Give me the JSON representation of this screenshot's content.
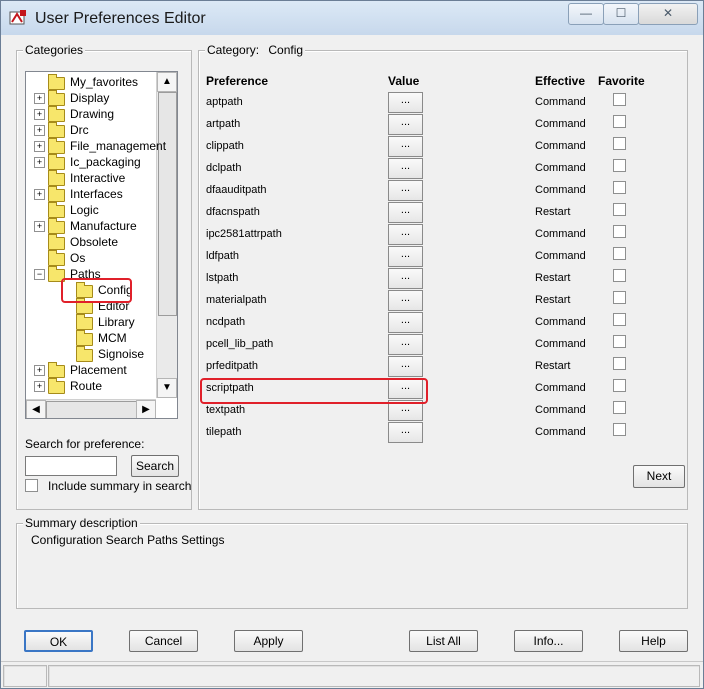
{
  "window": {
    "title": "User Preferences Editor",
    "minimize": "—",
    "maximize": "☐",
    "close": "✕"
  },
  "categories": {
    "label": "Categories",
    "items": [
      {
        "label": "My_favorites",
        "expander": ""
      },
      {
        "label": "Display",
        "expander": "+"
      },
      {
        "label": "Drawing",
        "expander": "+"
      },
      {
        "label": "Drc",
        "expander": "+"
      },
      {
        "label": "File_management",
        "expander": "+"
      },
      {
        "label": "Ic_packaging",
        "expander": "+"
      },
      {
        "label": "Interactive",
        "expander": ""
      },
      {
        "label": "Interfaces",
        "expander": "+"
      },
      {
        "label": "Logic",
        "expander": ""
      },
      {
        "label": "Manufacture",
        "expander": "+"
      },
      {
        "label": "Obsolete",
        "expander": ""
      },
      {
        "label": "Os",
        "expander": ""
      },
      {
        "label": "Paths",
        "expander": "−"
      },
      {
        "label": "Config",
        "expander": ""
      },
      {
        "label": "Editor",
        "expander": ""
      },
      {
        "label": "Library",
        "expander": ""
      },
      {
        "label": "MCM",
        "expander": ""
      },
      {
        "label": "Signoise",
        "expander": ""
      },
      {
        "label": "Placement",
        "expander": "+"
      },
      {
        "label": "Route",
        "expander": "+"
      }
    ],
    "selected": "Config",
    "scroll_up": "▲",
    "scroll_down": "▼",
    "scroll_left": "◀",
    "scroll_right": "▶"
  },
  "search": {
    "label": "Search for preference:",
    "value": "",
    "button": "Search",
    "include_summary_label": "Include summary in search",
    "include_summary_checked": false
  },
  "category_panel": {
    "label": "Category:",
    "name": "Config",
    "headers": {
      "preference": "Preference",
      "value": "Value",
      "effective": "Effective",
      "favorite": "Favorite"
    },
    "rows": [
      {
        "name": "aptpath",
        "value": "...",
        "effective": "Command",
        "favorite": false
      },
      {
        "name": "artpath",
        "value": "...",
        "effective": "Command",
        "favorite": false
      },
      {
        "name": "clippath",
        "value": "...",
        "effective": "Command",
        "favorite": false
      },
      {
        "name": "dclpath",
        "value": "...",
        "effective": "Command",
        "favorite": false
      },
      {
        "name": "dfaauditpath",
        "value": "...",
        "effective": "Command",
        "favorite": false
      },
      {
        "name": "dfacnspath",
        "value": "...",
        "effective": "Restart",
        "favorite": false
      },
      {
        "name": "ipc2581attrpath",
        "value": "...",
        "effective": "Command",
        "favorite": false
      },
      {
        "name": "ldfpath",
        "value": "...",
        "effective": "Command",
        "favorite": false
      },
      {
        "name": "lstpath",
        "value": "...",
        "effective": "Restart",
        "favorite": false
      },
      {
        "name": "materialpath",
        "value": "...",
        "effective": "Restart",
        "favorite": false
      },
      {
        "name": "ncdpath",
        "value": "...",
        "effective": "Command",
        "favorite": false
      },
      {
        "name": "pcell_lib_path",
        "value": "...",
        "effective": "Command",
        "favorite": false
      },
      {
        "name": "prfeditpath",
        "value": "...",
        "effective": "Restart",
        "favorite": false
      },
      {
        "name": "scriptpath",
        "value": "...",
        "effective": "Command",
        "favorite": false
      },
      {
        "name": "textpath",
        "value": "...",
        "effective": "Command",
        "favorite": false
      },
      {
        "name": "tilepath",
        "value": "...",
        "effective": "Command",
        "favorite": false
      }
    ],
    "highlighted_row": "scriptpath",
    "next_button": "Next"
  },
  "summary": {
    "label": "Summary description",
    "text": "Configuration Search Paths Settings"
  },
  "buttons": {
    "ok": "OK",
    "cancel": "Cancel",
    "apply": "Apply",
    "list_all": "List All",
    "info": "Info...",
    "help": "Help"
  },
  "colors": {
    "highlight_border": "#e0202a",
    "folder_fill": "#f7e66b"
  }
}
